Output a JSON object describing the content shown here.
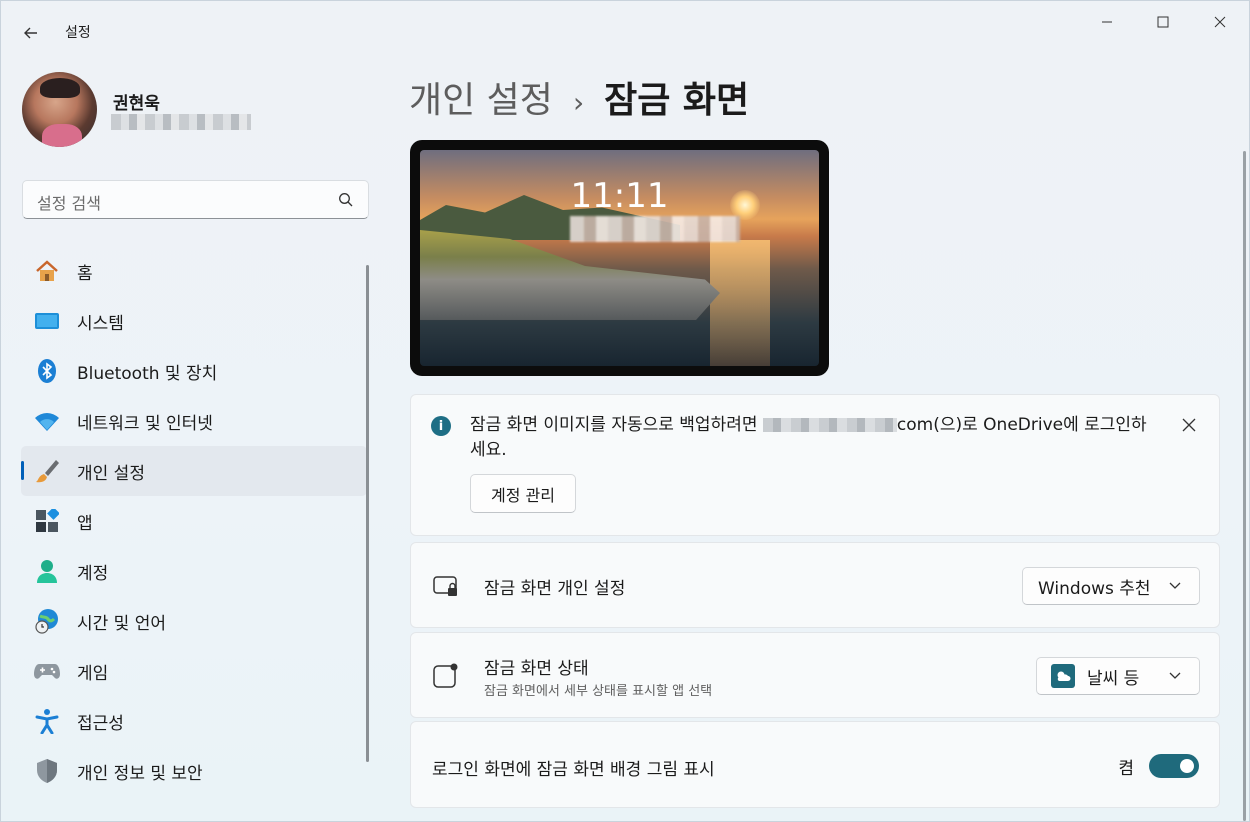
{
  "window": {
    "title": "설정",
    "controls": {
      "minimize": "minimize",
      "maximize": "maximize",
      "close": "close"
    }
  },
  "profile": {
    "name": "권현욱"
  },
  "search": {
    "placeholder": "설정 검색"
  },
  "sidebar": {
    "items": [
      {
        "label": "홈",
        "icon": "home-icon"
      },
      {
        "label": "시스템",
        "icon": "system-icon"
      },
      {
        "label": "Bluetooth 및 장치",
        "icon": "bluetooth-icon"
      },
      {
        "label": "네트워크 및 인터넷",
        "icon": "wifi-icon"
      },
      {
        "label": "개인 설정",
        "icon": "brush-icon",
        "active": true
      },
      {
        "label": "앱",
        "icon": "apps-icon"
      },
      {
        "label": "계정",
        "icon": "account-icon"
      },
      {
        "label": "시간 및 언어",
        "icon": "globe-clock-icon"
      },
      {
        "label": "게임",
        "icon": "gamepad-icon"
      },
      {
        "label": "접근성",
        "icon": "accessibility-icon"
      },
      {
        "label": "개인 정보 및 보안",
        "icon": "shield-icon"
      }
    ]
  },
  "breadcrumb": {
    "parent": "개인 설정",
    "separator": "›",
    "current": "잠금 화면"
  },
  "preview": {
    "time": "11:11"
  },
  "info_bar": {
    "text_before": "잠금 화면 이미지를 자동으로 백업하려면",
    "text_after": "com(으)로 OneDrive에 로그인하세요.",
    "button": "계정 관리"
  },
  "settings": {
    "personalize": {
      "title": "잠금 화면 개인 설정",
      "value": "Windows 추천"
    },
    "status": {
      "title": "잠금 화면 상태",
      "subtitle": "잠금 화면에서 세부 상태를 표시할 앱 선택",
      "value": "날씨 등"
    },
    "signin_bg": {
      "title": "로그인 화면에 잠금 화면 배경 그림 표시",
      "state": "켬",
      "on": true
    }
  },
  "colors": {
    "accent": "#005fb8",
    "toggle": "#1f6a7c"
  }
}
